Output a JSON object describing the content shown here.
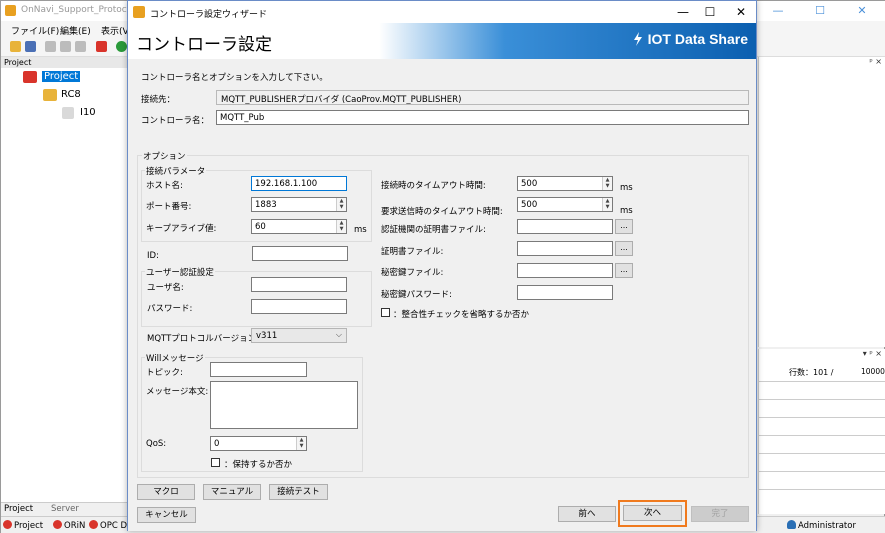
{
  "background_app": {
    "title": "OnNavi_Support_Protocol_M",
    "menu": [
      "ファイル(F)",
      "編集(E)",
      "表示(V"
    ],
    "window_controls": {
      "minimize": "—",
      "maximize": "☐",
      "close": "✕"
    },
    "project_panel": {
      "header": "Project",
      "tree": [
        {
          "label": "Project",
          "selected": true
        },
        {
          "label": "RC8",
          "selected": false
        },
        {
          "label": "I10",
          "selected": false
        }
      ]
    },
    "right_panel": {
      "pin_icons": "ᵖ ×",
      "pin_icons_2": "▾ ᵖ ×",
      "rows_label": "行数：101 /",
      "rows_total": "10000"
    },
    "bottom_tabs": [
      "Project",
      "Server"
    ],
    "status_items": [
      "Project",
      "ORiN",
      "OPC DA",
      "Administrator"
    ]
  },
  "dialog": {
    "title": "コントローラ設定ウィザード",
    "window_controls": {
      "minimize": "—",
      "maximize": "☐",
      "close": "✕"
    },
    "header_title": "コントローラ設定",
    "brand": "IOT Data Share",
    "instruction": "コントローラ名とオプションを入力して下さい。",
    "connection_label": "接続先：",
    "connection_value": "MQTT_PUBLISHERプロバイダ (CaoProv.MQTT_PUBLISHER)",
    "controller_name_label": "コントローラ名：",
    "controller_name_value": "MQTT_Pub",
    "options_title": "オプション",
    "connection_params": {
      "title": "接続パラメータ",
      "host_label": "ホスト名:",
      "host_value": "192.168.1.100",
      "port_label": "ポート番号:",
      "port_value": "1883",
      "keepalive_label": "キープアライブ値:",
      "keepalive_value": "60",
      "keepalive_unit": "ms"
    },
    "id_label": "ID:",
    "id_value": "",
    "user_auth": {
      "title": "ユーザー認証設定",
      "user_label": "ユーザ名:",
      "user_value": "",
      "password_label": "パスワード:",
      "password_value": ""
    },
    "mqtt_version_label": "MQTTプロトコルバージョン:",
    "mqtt_version_value": "v311",
    "will_message": {
      "title": "Willメッセージ",
      "topic_label": "トピック:",
      "topic_value": "",
      "body_label": "メッセージ本文:",
      "qos_label": "QoS:",
      "qos_value": "0",
      "retain_label": "：保持するか否か"
    },
    "right_options": {
      "conn_timeout_label": "接続時のタイムアウト時間:",
      "conn_timeout_value": "500",
      "conn_timeout_unit": "ms",
      "req_timeout_label": "要求送信時のタイムアウト時間:",
      "req_timeout_value": "500",
      "req_timeout_unit": "ms",
      "ca_cert_label": "認証機関の証明書ファイル:",
      "cert_label": "証明書ファイル:",
      "private_key_label": "秘密鍵ファイル:",
      "key_password_label": "秘密鍵パスワード:",
      "browse_label": "...",
      "integrity_label": "：整合性チェックを省略するか否か"
    },
    "buttons": {
      "macro": "マクロ",
      "manual": "マニュアル",
      "connection_test": "接続テスト",
      "cancel": "キャンセル",
      "back": "前へ",
      "next": "次へ",
      "finish": "完了"
    }
  },
  "colors": {
    "accent_highlight": "#f07a1e",
    "header_blue": "#0b5fb0",
    "selection_blue": "#0078d7",
    "status_red": "#d9342b"
  }
}
